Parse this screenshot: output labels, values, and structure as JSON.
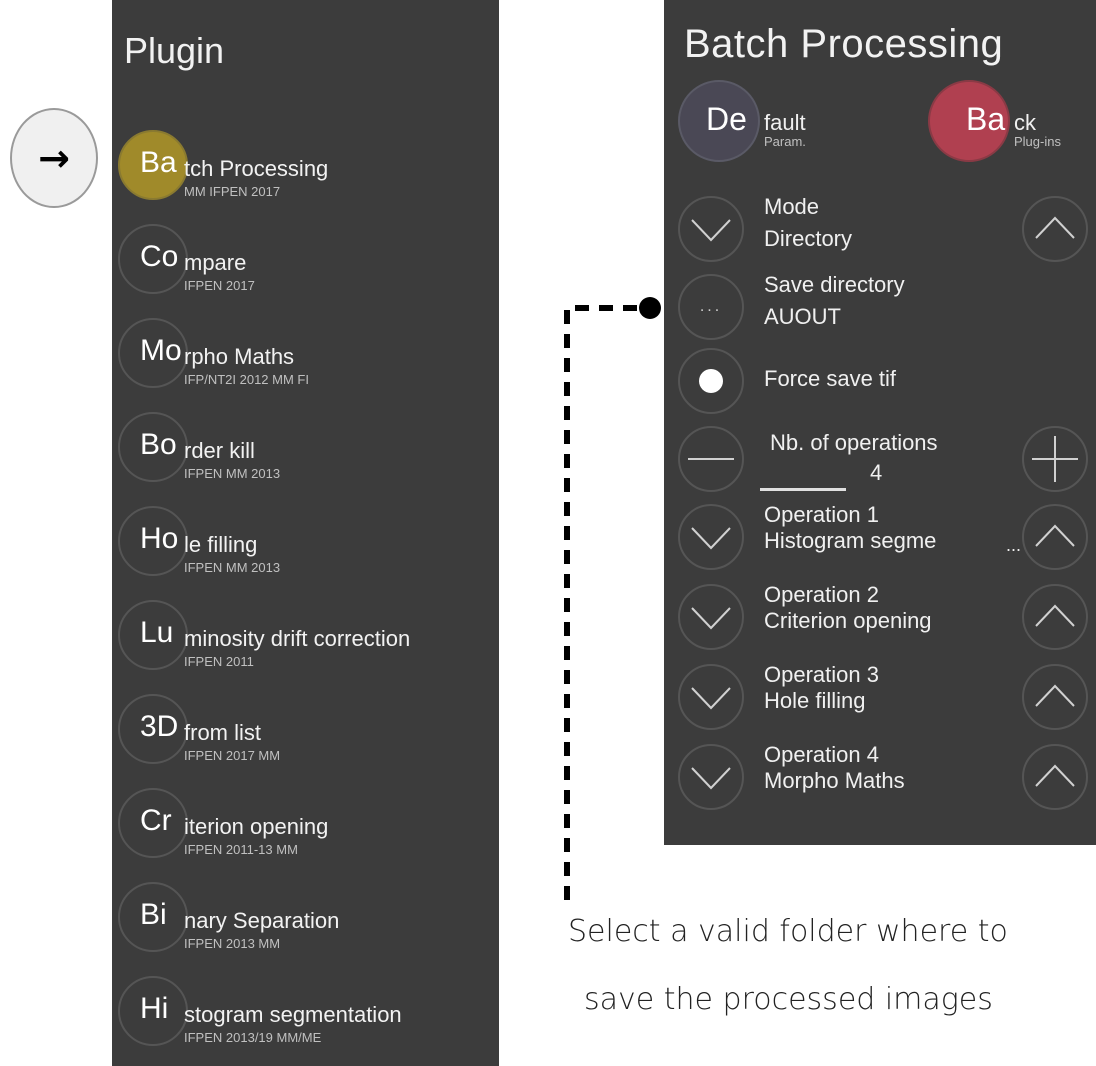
{
  "plugin_panel": {
    "title": "Plugin",
    "items": [
      {
        "abbr": "Ba",
        "rest": "tch Processing",
        "sub": "MM IFPEN 2017",
        "selected": true
      },
      {
        "abbr": "Co",
        "rest": "mpare",
        "sub": "IFPEN 2017"
      },
      {
        "abbr": "Mo",
        "rest": "rpho Maths",
        "sub": "IFP/NT2I 2012 MM FI"
      },
      {
        "abbr": "Bo",
        "rest": "rder kill",
        "sub": "IFPEN MM 2013"
      },
      {
        "abbr": "Ho",
        "rest": "le filling",
        "sub": "IFPEN MM 2013"
      },
      {
        "abbr": "Lu",
        "rest": "minosity drift correction",
        "sub": "IFPEN 2011"
      },
      {
        "abbr": "3D",
        "rest": "from list",
        "sub": "IFPEN 2017 MM"
      },
      {
        "abbr": "Cr",
        "rest": "iterion opening",
        "sub": "IFPEN 2011-13 MM"
      },
      {
        "abbr": "Bi",
        "rest": "nary Separation",
        "sub": "IFPEN 2013 MM"
      },
      {
        "abbr": "Hi",
        "rest": "stogram segmentation",
        "sub": "IFPEN 2013/19 MM/ME"
      }
    ]
  },
  "arrow_button": {
    "glyph": "→"
  },
  "batch_panel": {
    "title": "Batch Processing",
    "default": {
      "abbr": "De",
      "rest": "fault",
      "sub": "Param."
    },
    "back": {
      "abbr": "Ba",
      "rest": "ck",
      "sub": "Plug-ins"
    },
    "mode": {
      "label": "Mode",
      "value": "Directory"
    },
    "save_directory": {
      "label": "Save directory",
      "value": "AUOUT",
      "button": "..."
    },
    "force_save": {
      "label": "Force save tif"
    },
    "nb_operations": {
      "label": "Nb. of operations",
      "value": "4"
    },
    "operations": [
      {
        "label": "Operation 1",
        "value": "Histogram segme",
        "more": "..."
      },
      {
        "label": "Operation 2",
        "value": "Criterion opening"
      },
      {
        "label": "Operation 3",
        "value": "Hole filling"
      },
      {
        "label": "Operation 4",
        "value": "Morpho Maths"
      }
    ]
  },
  "caption": {
    "line1": "Select a valid folder where to",
    "line2": "save the processed images"
  },
  "colors": {
    "panel_bg": "#3c3c3c",
    "selected_circle": "#a08a2a",
    "default_circle": "#4a4855",
    "back_circle": "#b04050"
  }
}
